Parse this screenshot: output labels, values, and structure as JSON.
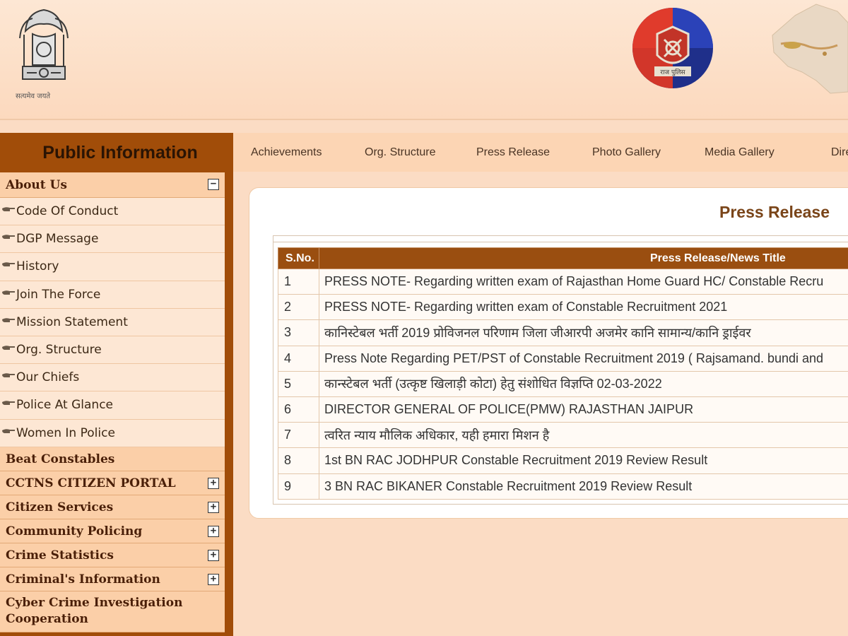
{
  "header": {
    "emblem_caption": "सत्यमेव जयते",
    "police_logo_label": "राज पुलिस"
  },
  "sidebar": {
    "title": "Public Information",
    "about": {
      "label": "About Us",
      "toggle": "−"
    },
    "about_items": [
      {
        "label": "Code Of Conduct"
      },
      {
        "label": "DGP Message"
      },
      {
        "label": "History"
      },
      {
        "label": "Join The Force"
      },
      {
        "label": "Mission Statement"
      },
      {
        "label": "Org. Structure"
      },
      {
        "label": "Our Chiefs"
      },
      {
        "label": "Police At Glance"
      },
      {
        "label": "Women In Police"
      }
    ],
    "sections": [
      {
        "label": "Beat Constables",
        "toggle": ""
      },
      {
        "label": "CCTNS CITIZEN PORTAL",
        "toggle": "+"
      },
      {
        "label": "Citizen Services",
        "toggle": "+"
      },
      {
        "label": "Community Policing",
        "toggle": "+"
      },
      {
        "label": "Crime Statistics",
        "toggle": "+"
      },
      {
        "label": "Criminal's Information",
        "toggle": "+"
      },
      {
        "label": "Cyber Crime Investigation Cooperation",
        "toggle": ""
      }
    ]
  },
  "topnav": {
    "items": [
      {
        "label": "Achievements"
      },
      {
        "label": "Org. Structure"
      },
      {
        "label": "Press Release"
      },
      {
        "label": "Photo Gallery"
      },
      {
        "label": "Media Gallery"
      },
      {
        "label": "Dire"
      }
    ]
  },
  "main": {
    "title": "Press Release",
    "table": {
      "columns": [
        "S.No.",
        "Press Release/News Title"
      ],
      "rows": [
        {
          "sno": "1",
          "title": "PRESS NOTE- Regarding written exam of Rajasthan Home Guard HC/ Constable Recru"
        },
        {
          "sno": "2",
          "title": "PRESS NOTE- Regarding written exam of Constable Recruitment 2021"
        },
        {
          "sno": "3",
          "title": "कानिस्टेबल भर्ती 2019 प्रोविजनल परिणाम जिला जीआरपी अजमेर कानि सामान्य/कानि ड्राईवर"
        },
        {
          "sno": "4",
          "title": "Press Note Regarding PET/PST of Constable Recruitment 2019 ( Rajsamand. bundi and"
        },
        {
          "sno": "5",
          "title": "कान्स्टेबल भर्ती (उत्कृष्ट खिलाड़ी कोटा) हेतु संशोधित विज्ञप्ति 02-03-2022"
        },
        {
          "sno": "6",
          "title": "DIRECTOR GENERAL OF POLICE(PMW) RAJASTHAN JAIPUR"
        },
        {
          "sno": "7",
          "title": "त्वरित न्याय मौलिक अधिकार, यही हमारा मिशन है"
        },
        {
          "sno": "8",
          "title": "1st BN RAC JODHPUR Constable Recruitment 2019 Review Result"
        },
        {
          "sno": "9",
          "title": "3 BN RAC BIKANER Constable Recruitment 2019 Review Result"
        }
      ]
    }
  },
  "colors": {
    "sidebar_bg": "#a14d09",
    "table_header_bg": "#9a4e10",
    "page_bg": "#fbdcc4"
  }
}
